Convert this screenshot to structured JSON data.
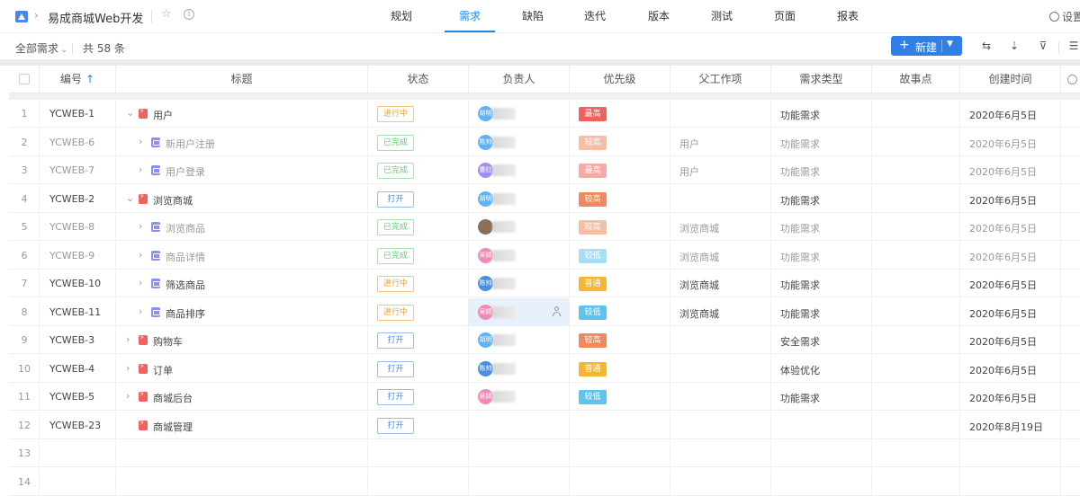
{
  "header": {
    "project_title": "易成商城Web开发",
    "tabs": [
      {
        "label": "规划",
        "active": false
      },
      {
        "label": "需求",
        "active": true
      },
      {
        "label": "缺陷",
        "active": false
      },
      {
        "label": "迭代",
        "active": false
      },
      {
        "label": "版本",
        "active": false
      },
      {
        "label": "测试",
        "active": false
      },
      {
        "label": "页面",
        "active": false
      },
      {
        "label": "报表",
        "active": false
      }
    ],
    "settings_label": "设置"
  },
  "toolbar": {
    "filter_label": "全部需求",
    "total_count": "共 58 条",
    "new_button_label": "新建"
  },
  "table": {
    "columns": {
      "id": "编号",
      "title": "标题",
      "status": "状态",
      "owner": "负责人",
      "priority": "优先级",
      "parent": "父工作项",
      "req_type": "需求类型",
      "story_points": "故事点",
      "created": "创建时间"
    },
    "rows": [
      {
        "num": "1",
        "id": "YCWEB-1",
        "title": "用户",
        "kind": "epic",
        "expanded": true,
        "child": false,
        "dim": false,
        "status": "进行中",
        "status_kind": "progress",
        "owner_initials": "胡明",
        "avatar_color": "#5fb2f5",
        "priority": "最高",
        "priority_color": "#f0635c",
        "parent": "",
        "req_type": "功能需求",
        "created": "2020年6月5日"
      },
      {
        "num": "2",
        "id": "YCWEB-6",
        "title": "新用户注册",
        "kind": "story",
        "expanded": false,
        "child": true,
        "dim": true,
        "status": "已完成",
        "status_kind": "done",
        "owner_initials": "陈帅",
        "avatar_color": "#5fb2f5",
        "priority": "较高",
        "priority_color": "#f08a5c",
        "parent": "用户",
        "req_type": "功能需求",
        "created": "2020年6月5日"
      },
      {
        "num": "3",
        "id": "YCWEB-7",
        "title": "用户登录",
        "kind": "story",
        "expanded": false,
        "child": true,
        "dim": true,
        "status": "已完成",
        "status_kind": "done",
        "owner_initials": "曹红",
        "avatar_color": "#a68ef0",
        "priority": "最高",
        "priority_color": "#f0635c",
        "parent": "用户",
        "req_type": "功能需求",
        "created": "2020年6月5日"
      },
      {
        "num": "4",
        "id": "YCWEB-2",
        "title": "浏览商城",
        "kind": "epic",
        "expanded": true,
        "child": false,
        "dim": false,
        "status": "打开",
        "status_kind": "open",
        "owner_initials": "胡明",
        "avatar_color": "#5fb2f5",
        "priority": "较高",
        "priority_color": "#f08a5c",
        "parent": "",
        "req_type": "功能需求",
        "created": "2020年6月5日"
      },
      {
        "num": "5",
        "id": "YCWEB-8",
        "title": "浏览商品",
        "kind": "story",
        "expanded": false,
        "child": true,
        "dim": true,
        "status": "已完成",
        "status_kind": "done",
        "owner_initials": "",
        "avatar_color": "#8a6f5a",
        "priority": "较高",
        "priority_color": "#f08a5c",
        "parent": "浏览商城",
        "req_type": "功能需求",
        "created": "2020年6月5日"
      },
      {
        "num": "6",
        "id": "YCWEB-9",
        "title": "商品详情",
        "kind": "story",
        "expanded": false,
        "child": true,
        "dim": true,
        "status": "已完成",
        "status_kind": "done",
        "owner_initials": "吴婧",
        "avatar_color": "#f08ab8",
        "priority": "较低",
        "priority_color": "#5ec4ef",
        "parent": "浏览商城",
        "req_type": "功能需求",
        "created": "2020年6月5日"
      },
      {
        "num": "7",
        "id": "YCWEB-10",
        "title": "筛选商品",
        "kind": "story",
        "expanded": false,
        "child": true,
        "dim": false,
        "status": "进行中",
        "status_kind": "progress",
        "owner_initials": "陈帅",
        "avatar_color": "#4a8fe0",
        "priority": "普通",
        "priority_color": "#f5b731",
        "parent": "浏览商城",
        "req_type": "功能需求",
        "created": "2020年6月5日"
      },
      {
        "num": "8",
        "id": "YCWEB-11",
        "title": "商品排序",
        "kind": "story",
        "expanded": false,
        "child": true,
        "dim": false,
        "status": "进行中",
        "status_kind": "progress",
        "owner_initials": "吴婧",
        "avatar_color": "#f08ab8",
        "priority": "较低",
        "priority_color": "#5ec4ef",
        "parent": "浏览商城",
        "req_type": "功能需求",
        "created": "2020年6月5日",
        "highlight": true
      },
      {
        "num": "9",
        "id": "YCWEB-3",
        "title": "购物车",
        "kind": "epic",
        "expanded": false,
        "child": false,
        "dim": false,
        "status": "打开",
        "status_kind": "open",
        "owner_initials": "胡明",
        "avatar_color": "#5fb2f5",
        "priority": "较高",
        "priority_color": "#f08a5c",
        "parent": "",
        "req_type": "安全需求",
        "created": "2020年6月5日"
      },
      {
        "num": "10",
        "id": "YCWEB-4",
        "title": "订单",
        "kind": "epic",
        "expanded": false,
        "child": false,
        "dim": false,
        "status": "打开",
        "status_kind": "open",
        "owner_initials": "陈帅",
        "avatar_color": "#4a8fe0",
        "priority": "普通",
        "priority_color": "#f5b731",
        "parent": "",
        "req_type": "体验优化",
        "created": "2020年6月5日"
      },
      {
        "num": "11",
        "id": "YCWEB-5",
        "title": "商城后台",
        "kind": "epic",
        "expanded": false,
        "child": false,
        "dim": false,
        "status": "打开",
        "status_kind": "open",
        "owner_initials": "吴婧",
        "avatar_color": "#f08ab8",
        "priority": "较低",
        "priority_color": "#5ec4ef",
        "parent": "",
        "req_type": "功能需求",
        "created": "2020年6月5日"
      },
      {
        "num": "12",
        "id": "YCWEB-23",
        "title": "商城管理",
        "kind": "epic",
        "expanded": false,
        "child": false,
        "dim": false,
        "no_expander": true,
        "status": "打开",
        "status_kind": "open",
        "owner_initials": "",
        "avatar_color": "",
        "priority": "",
        "priority_color": "",
        "parent": "",
        "req_type": "",
        "created": "2020年8月19日"
      },
      {
        "num": "13",
        "empty": true
      },
      {
        "num": "14",
        "empty": true
      }
    ]
  }
}
